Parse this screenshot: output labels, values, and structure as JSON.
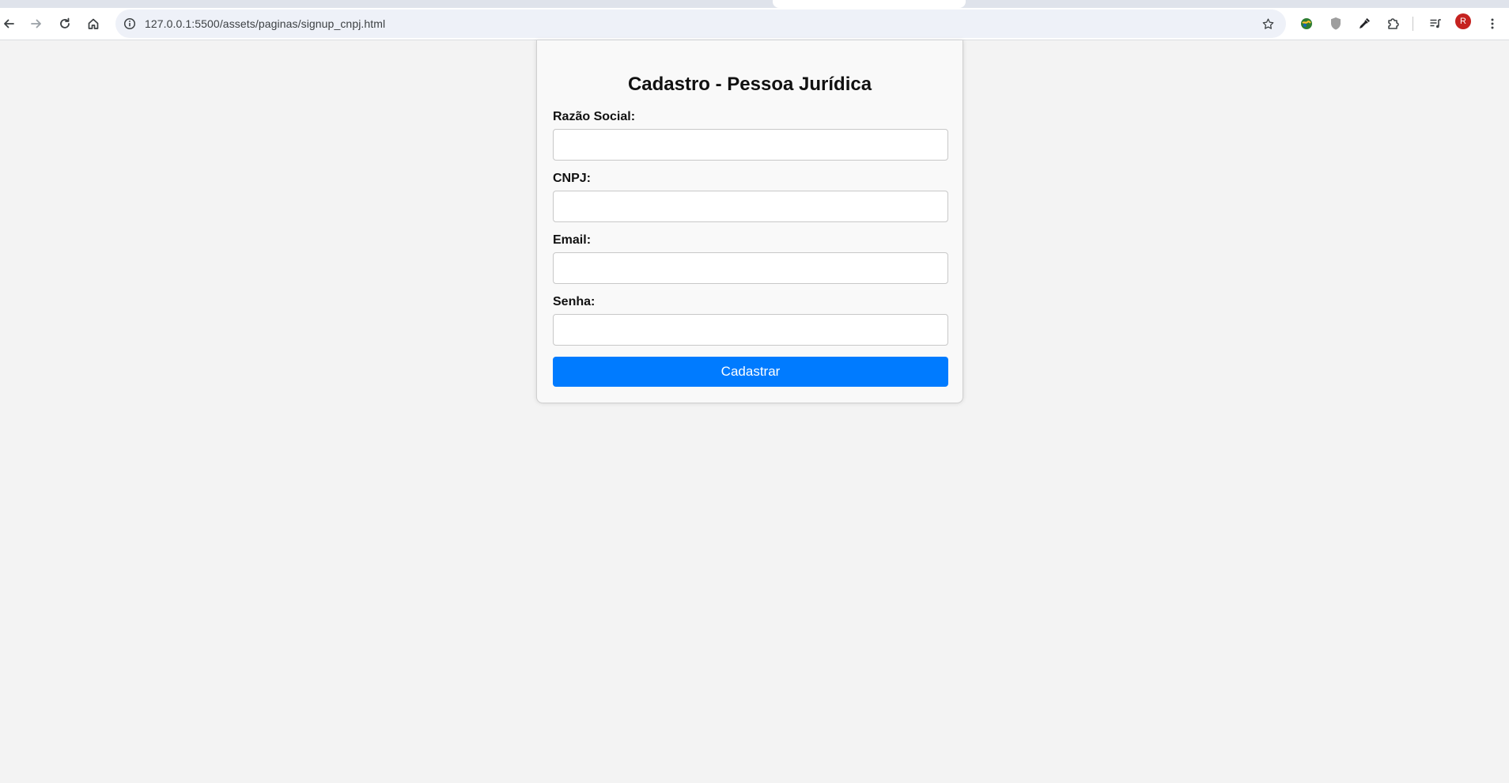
{
  "browser": {
    "url": "127.0.0.1:5500/assets/paginas/signup_cnpj.html",
    "profile_initial": "R",
    "icons": {
      "back": "arrow-left-icon",
      "forward": "arrow-right-icon",
      "reload": "reload-icon",
      "home": "home-icon",
      "site_info": "info-icon",
      "bookmark": "star-icon",
      "extension_1": "globe-extension-icon",
      "extension_2": "shield-extension-icon",
      "extension_3": "eyedropper-icon",
      "extensions": "puzzle-icon",
      "media": "media-playlist-icon",
      "menu": "kebab-menu-icon"
    }
  },
  "form": {
    "title": "Cadastro - Pessoa Jurídica",
    "fields": [
      {
        "label": "Razão Social:",
        "value": "",
        "placeholder": ""
      },
      {
        "label": "CNPJ:",
        "value": "",
        "placeholder": ""
      },
      {
        "label": "Email:",
        "value": "",
        "placeholder": ""
      },
      {
        "label": "Senha:",
        "value": "",
        "placeholder": ""
      }
    ],
    "submit_label": "Cadastrar"
  },
  "colors": {
    "page_background": "#f3f3f3",
    "card_background": "#f9f9f9",
    "primary_button": "#007bff",
    "profile_avatar": "#c5221f"
  }
}
